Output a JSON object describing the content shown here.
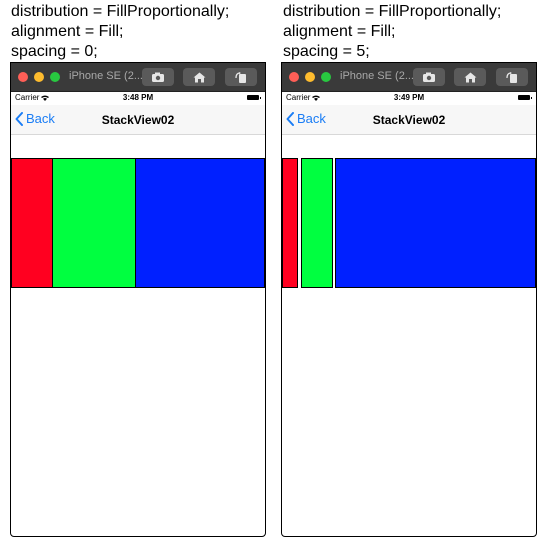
{
  "panels": [
    {
      "caption": [
        "distribution = FillProportionally;",
        "alignment = Fill;",
        "spacing = 0;"
      ],
      "device_name": "iPhone SE (2...",
      "carrier": "Carrier",
      "time": "3:48 PM",
      "back_label": "Back",
      "nav_title": "StackView02",
      "stack_bars": [
        {
          "color": "red"
        },
        {
          "color": "green"
        },
        {
          "color": "blue"
        }
      ]
    },
    {
      "caption": [
        "distribution = FillProportionally;",
        "alignment = Fill;",
        "spacing = 5;"
      ],
      "device_name": "iPhone SE (2...",
      "carrier": "Carrier",
      "time": "3:49 PM",
      "back_label": "Back",
      "nav_title": "StackView02",
      "stack_bars": [
        {
          "color": "red"
        },
        {
          "color": "green"
        },
        {
          "color": "blue"
        }
      ]
    }
  ],
  "colors": {
    "red": "#ff0020",
    "green": "#00ff40",
    "blue": "#0020ff",
    "accent": "#1a7df5"
  }
}
